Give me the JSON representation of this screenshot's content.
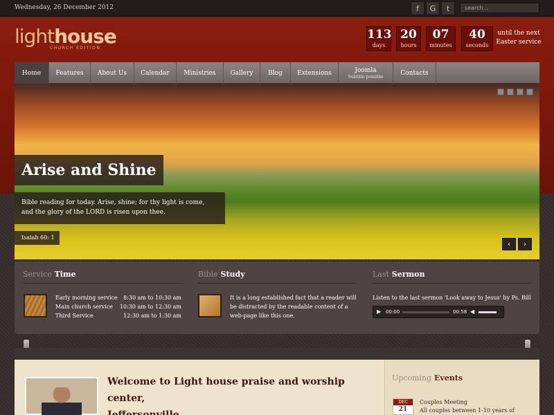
{
  "topbar": {
    "date": "Wednesday, 26 December 2012",
    "search_placeholder": "search...",
    "social": [
      {
        "icon": "facebook-icon",
        "glyph": "f"
      },
      {
        "icon": "google-icon",
        "glyph": "G"
      },
      {
        "icon": "twitter-icon",
        "glyph": "t"
      }
    ]
  },
  "logo": {
    "light": "light",
    "house": "house",
    "sub": "CHURCH EDITION"
  },
  "countdown": {
    "items": [
      {
        "num": "113",
        "label": "days"
      },
      {
        "num": "20",
        "label": "hours"
      },
      {
        "num": "07",
        "label": "minutes"
      },
      {
        "num": "40",
        "label": "seconds"
      }
    ],
    "until_line1": "until the next",
    "until_line2": "Easter service"
  },
  "nav": [
    {
      "label": "Home"
    },
    {
      "label": "Features"
    },
    {
      "label": "About Us"
    },
    {
      "label": "Calendar"
    },
    {
      "label": "Ministries"
    },
    {
      "label": "Gallery"
    },
    {
      "label": "Blog"
    },
    {
      "label": "Extensions"
    },
    {
      "label": "Joomla",
      "sub": "Subtitle possible"
    },
    {
      "label": "Contacts"
    }
  ],
  "hero": {
    "title": "Arise and Shine",
    "text": "Bible reading for today. Arise, shine; for thy light is come, and the glory of the LORD is risen upon thee.",
    "reference": "Isaiah 60: 1",
    "prev": "‹",
    "next": "›"
  },
  "service": {
    "title_muted": "Service",
    "title": "Time",
    "rows": [
      {
        "name": "Early morning service",
        "time": "8:30 am to 10:30 am"
      },
      {
        "name": "Main church service",
        "time": "10:30 am to 12:30 am"
      },
      {
        "name": "Third Service",
        "time": "12:30 am to 1:30 am"
      }
    ]
  },
  "bible": {
    "title_muted": "Bible",
    "title": "Study",
    "text": "It is a long established fact that a reader will be distracted by the readable content of a web-page like this one."
  },
  "sermon": {
    "title_muted": "Last",
    "title": "Sermon",
    "text": "Listen to the last sermon 'Look away to Jesus' by Ps. Bill",
    "player": {
      "time_current": "00:00",
      "time_total": "00:58"
    }
  },
  "welcome": {
    "line1": "Welcome to Light house praise and worship center,",
    "line2": "Jeffersonville"
  },
  "events": {
    "title_muted": "Upcoming",
    "title": "Events",
    "month": "DEC",
    "day": "21",
    "name": "Couples Meeting",
    "desc": "All couples between 1-10 years of"
  },
  "colors": {
    "red_band": "#8b1d0e",
    "nav": "#7a726e",
    "panel": "#4e4543",
    "cream": "#efe3cc"
  }
}
